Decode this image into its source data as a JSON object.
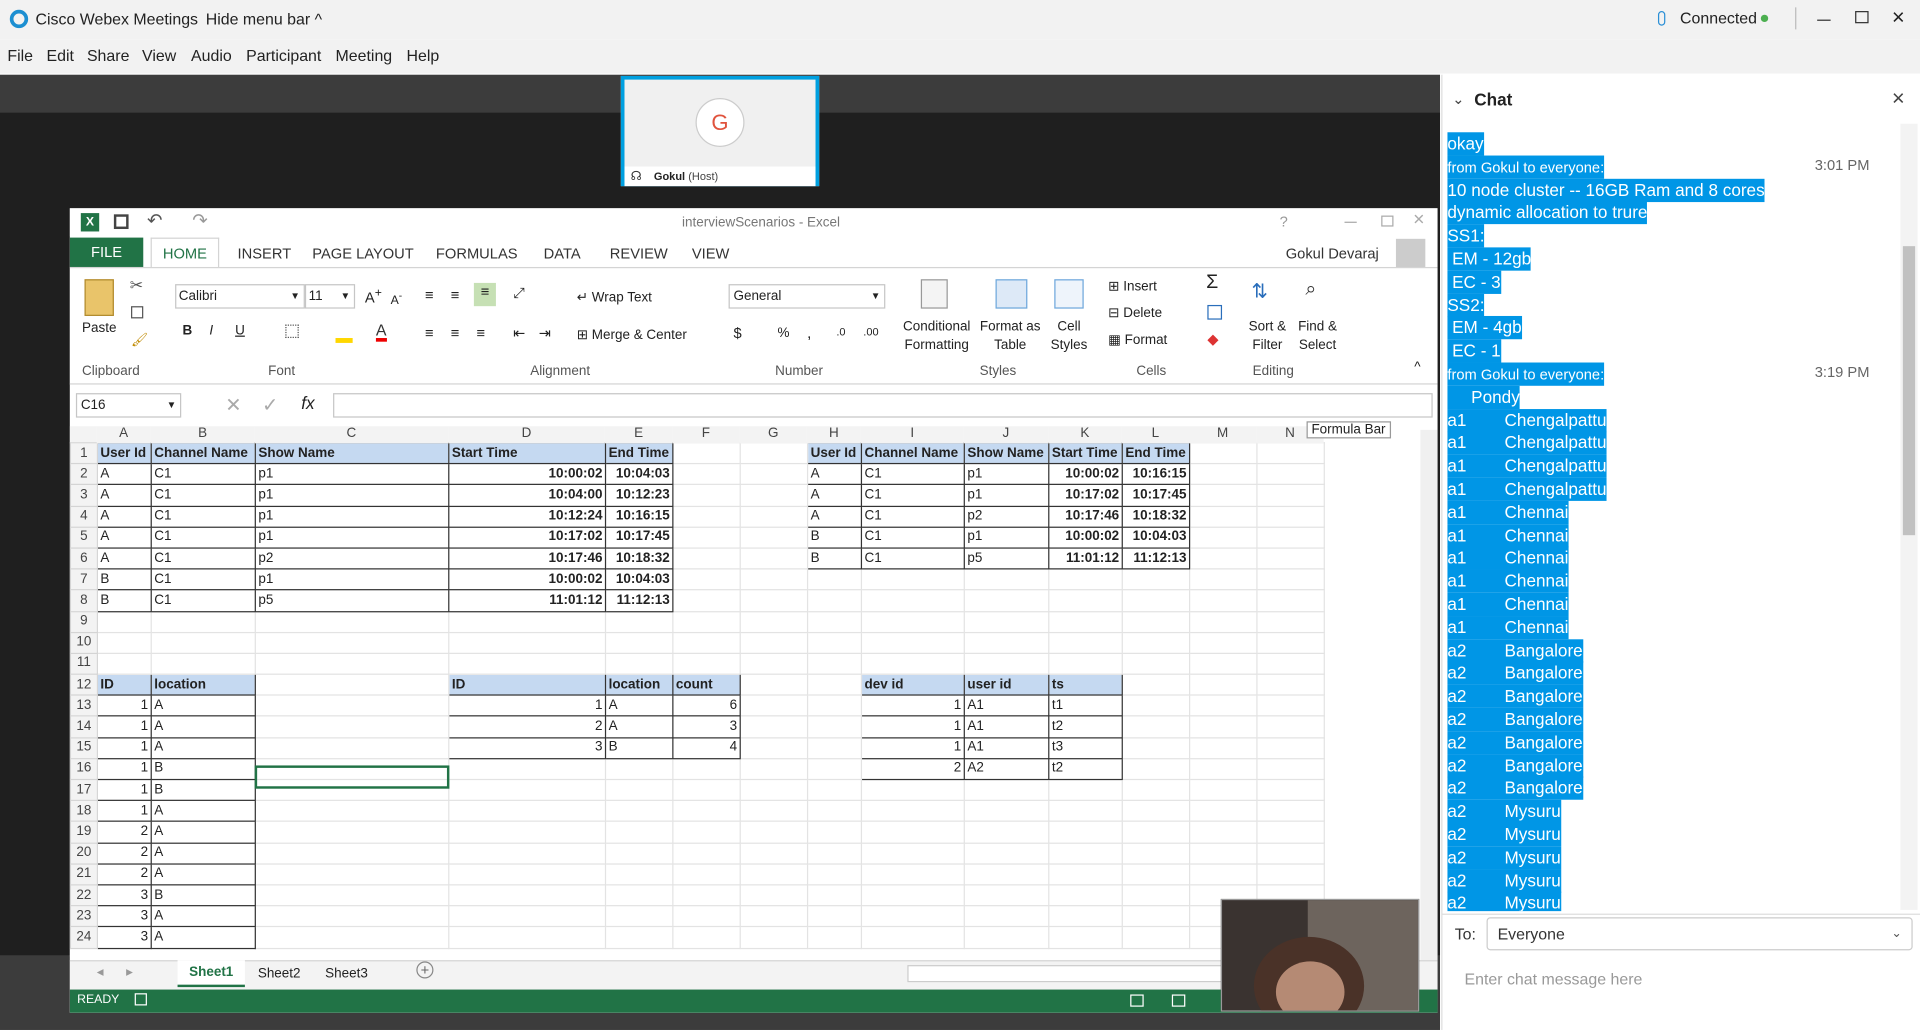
{
  "webex": {
    "app_title": "Cisco Webex Meetings",
    "hide_menu_bar": "Hide menu bar",
    "connection_status": "Connected",
    "menu": [
      "File",
      "Edit",
      "Share",
      "View",
      "Audio",
      "Participant",
      "Meeting",
      "Help"
    ],
    "participant": {
      "initial": "G",
      "name": "Gokul",
      "role": "(Host)"
    }
  },
  "excel": {
    "window_title": "interviewScenarios - Excel",
    "user": "Gokul Devaraj",
    "tabs": [
      "FILE",
      "HOME",
      "INSERT",
      "PAGE LAYOUT",
      "FORMULAS",
      "DATA",
      "REVIEW",
      "VIEW"
    ],
    "active_tab": "HOME",
    "font_name": "Calibri",
    "font_size": "11",
    "number_format": "General",
    "ribbon": {
      "paste": "Paste",
      "wrap_text": "Wrap Text",
      "merge_center": "Merge & Center",
      "conditional_formatting": [
        "Conditional",
        "Formatting"
      ],
      "format_as_table": [
        "Format as",
        "Table"
      ],
      "cell_styles": [
        "Cell",
        "Styles"
      ],
      "insert": "Insert",
      "delete": "Delete",
      "format": "Format",
      "sort_filter": [
        "Sort &",
        "Filter"
      ],
      "find_select": [
        "Find &",
        "Select"
      ],
      "groups": [
        "Clipboard",
        "Font",
        "Alignment",
        "Number",
        "Styles",
        "Cells",
        "Editing"
      ]
    },
    "name_box": "C16",
    "formula_bar_tooltip": "Formula Bar",
    "columns": [
      "A",
      "B",
      "C",
      "D",
      "E",
      "F",
      "G",
      "H",
      "I",
      "J",
      "K",
      "L",
      "M",
      "N"
    ],
    "rows": [
      [
        "User Id",
        "Channel Name",
        "Show Name",
        "Start Time",
        "End Time",
        "",
        "",
        "User Id",
        "Channel Name",
        "Show Name",
        "Start Time",
        "End Time",
        "",
        ""
      ],
      [
        "A",
        "C1",
        "p1",
        "10:00:02",
        "10:04:03",
        "",
        "",
        "A",
        "C1",
        "p1",
        "10:00:02",
        "10:16:15",
        "",
        ""
      ],
      [
        "A",
        "C1",
        "p1",
        "10:04:00",
        "10:12:23",
        "",
        "",
        "A",
        "C1",
        "p1",
        "10:17:02",
        "10:17:45",
        "",
        ""
      ],
      [
        "A",
        "C1",
        "p1",
        "10:12:24",
        "10:16:15",
        "",
        "",
        "A",
        "C1",
        "p2",
        "10:17:46",
        "10:18:32",
        "",
        ""
      ],
      [
        "A",
        "C1",
        "p1",
        "10:17:02",
        "10:17:45",
        "",
        "",
        "B",
        "C1",
        "p1",
        "10:00:02",
        "10:04:03",
        "",
        ""
      ],
      [
        "A",
        "C1",
        "p2",
        "10:17:46",
        "10:18:32",
        "",
        "",
        "B",
        "C1",
        "p5",
        "11:01:12",
        "11:12:13",
        "",
        ""
      ],
      [
        "B",
        "C1",
        "p1",
        "10:00:02",
        "10:04:03",
        "",
        "",
        "",
        "",
        "",
        "",
        "",
        "",
        ""
      ],
      [
        "B",
        "C1",
        "p5",
        "11:01:12",
        "11:12:13",
        "",
        "",
        "",
        "",
        "",
        "",
        "",
        "",
        ""
      ],
      [
        "",
        "",
        "",
        "",
        "",
        "",
        "",
        "",
        "",
        "",
        "",
        "",
        "",
        ""
      ],
      [
        "",
        "",
        "",
        "",
        "",
        "",
        "",
        "",
        "",
        "",
        "",
        "",
        "",
        ""
      ],
      [
        "",
        "",
        "",
        "",
        "",
        "",
        "",
        "",
        "",
        "",
        "",
        "",
        "",
        ""
      ],
      [
        "ID",
        "location",
        "",
        "ID",
        "location",
        "count",
        "",
        "",
        "dev id",
        "user id",
        "ts",
        "",
        "",
        ""
      ],
      [
        "1",
        "A",
        "",
        "1",
        "A",
        "6",
        "",
        "",
        "1",
        "A1",
        "t1",
        "",
        "",
        ""
      ],
      [
        "1",
        "A",
        "",
        "2",
        "A",
        "3",
        "",
        "",
        "1",
        "A1",
        "t2",
        "",
        "",
        ""
      ],
      [
        "1",
        "A",
        "",
        "3",
        "B",
        "4",
        "",
        "",
        "1",
        "A1",
        "t3",
        "",
        "",
        ""
      ],
      [
        "1",
        "B",
        "",
        "",
        "",
        "",
        "",
        "",
        "2",
        "A2",
        "t2",
        "",
        "",
        ""
      ],
      [
        "1",
        "B",
        "",
        "",
        "",
        "",
        "",
        "",
        "",
        "",
        "",
        "",
        "",
        ""
      ],
      [
        "1",
        "A",
        "",
        "",
        "",
        "",
        "",
        "",
        "",
        "",
        "",
        "",
        "",
        ""
      ],
      [
        "2",
        "A",
        "",
        "",
        "",
        "",
        "",
        "",
        "",
        "",
        "",
        "",
        "",
        ""
      ],
      [
        "2",
        "A",
        "",
        "",
        "",
        "",
        "",
        "",
        "",
        "",
        "",
        "",
        "",
        ""
      ],
      [
        "2",
        "A",
        "",
        "",
        "",
        "",
        "",
        "",
        "",
        "",
        "",
        "",
        "",
        ""
      ],
      [
        "3",
        "B",
        "",
        "",
        "",
        "",
        "",
        "",
        "",
        "",
        "",
        "",
        "",
        ""
      ],
      [
        "3",
        "A",
        "",
        "",
        "",
        "",
        "",
        "",
        "",
        "",
        "",
        "",
        "",
        ""
      ],
      [
        "3",
        "A",
        "",
        "",
        "",
        "",
        "",
        "",
        "",
        "",
        "",
        "",
        "",
        ""
      ]
    ],
    "sheets": [
      "Sheet1",
      "Sheet2",
      "Sheet3"
    ],
    "active_sheet": "Sheet1",
    "status": "READY"
  },
  "chat": {
    "title": "Chat",
    "lines": [
      {
        "text": "okay",
        "time": ""
      },
      {
        "text": "from Gokul to everyone:",
        "time": "3:01 PM",
        "meta": true
      },
      {
        "text": "10 node cluster -- 16GB Ram and 8 cores",
        "time": ""
      },
      {
        "text": "dynamic allocation to trure",
        "time": ""
      },
      {
        "text": "SS1:",
        "time": ""
      },
      {
        "text": " EM - 12gb",
        "time": ""
      },
      {
        "text": " EC - 3",
        "time": ""
      },
      {
        "text": "SS2:",
        "time": ""
      },
      {
        "text": " EM - 4gb",
        "time": ""
      },
      {
        "text": " EC - 1",
        "time": ""
      },
      {
        "text": "from Gokul to everyone:",
        "time": "3:19 PM",
        "meta": true
      },
      {
        "text": "     Pondy",
        "time": ""
      },
      {
        "text": "a1\t\tChengalpattu",
        "time": ""
      },
      {
        "text": "a1\t\tChengalpattu",
        "time": ""
      },
      {
        "text": "a1\t\tChengalpattu",
        "time": ""
      },
      {
        "text": "a1\t\tChengalpattu",
        "time": ""
      },
      {
        "text": "a1\t\tChennai",
        "time": ""
      },
      {
        "text": "a1\t\tChennai",
        "time": ""
      },
      {
        "text": "a1\t\tChennai",
        "time": ""
      },
      {
        "text": "a1\t\tChennai",
        "time": ""
      },
      {
        "text": "a1\t\tChennai",
        "time": ""
      },
      {
        "text": "a1\t\tChennai",
        "time": ""
      },
      {
        "text": "a2\t\tBangalore",
        "time": ""
      },
      {
        "text": "a2\t\tBangalore",
        "time": ""
      },
      {
        "text": "a2\t\tBangalore",
        "time": ""
      },
      {
        "text": "a2\t\tBangalore",
        "time": ""
      },
      {
        "text": "a2\t\tBangalore",
        "time": ""
      },
      {
        "text": "a2\t\tBangalore",
        "time": ""
      },
      {
        "text": "a2\t\tBangalore",
        "time": ""
      },
      {
        "text": "a2\t\tMysuru",
        "time": ""
      },
      {
        "text": "a2\t\tMysuru",
        "time": ""
      },
      {
        "text": "a2\t\tMysuru",
        "time": ""
      },
      {
        "text": "a2\t\tMysuru",
        "time": ""
      },
      {
        "text": "a2\t\tMysuru",
        "time": ""
      }
    ],
    "to_label": "To:",
    "recipient": "Everyone",
    "input_placeholder": "Enter chat message here"
  },
  "colors": {
    "accent": "#0096e6",
    "excel_green": "#217346",
    "header_fill": "#c5d9f1"
  }
}
